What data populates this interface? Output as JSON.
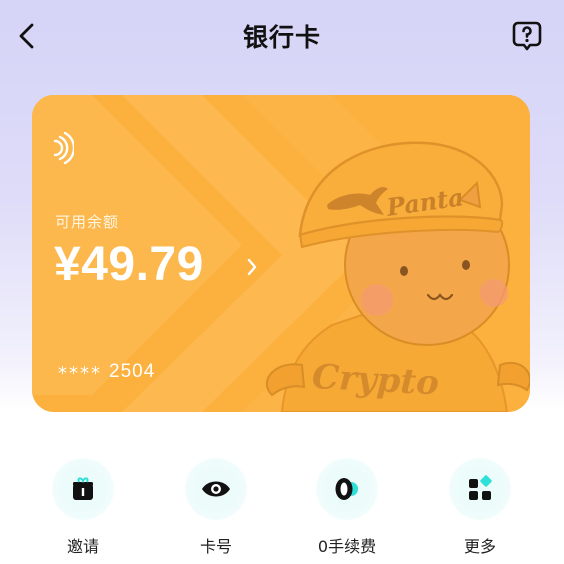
{
  "header": {
    "title": "银行卡"
  },
  "card": {
    "balance_label": "可用余额",
    "balance": "¥49.79",
    "masked": "****",
    "last4": "2504",
    "illustration_text_top": "Panta",
    "illustration_text_bottom": "Crypto",
    "color": "#fcb03e"
  },
  "actions": [
    {
      "label": "邀请",
      "icon": "gift-icon"
    },
    {
      "label": "卡号",
      "icon": "eye-icon"
    },
    {
      "label": "0手续费",
      "icon": "zero-fee-icon"
    },
    {
      "label": "更多",
      "icon": "grid-icon"
    }
  ]
}
